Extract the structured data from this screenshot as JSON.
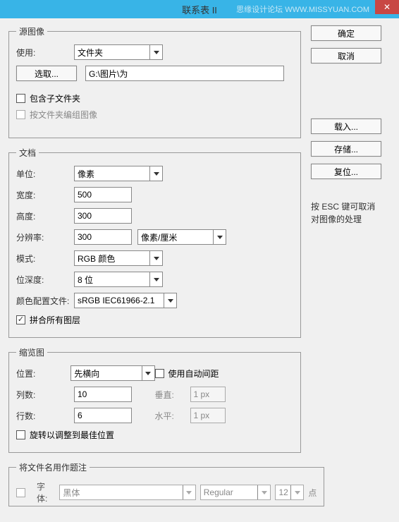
{
  "title": "联系表 II",
  "watermark": "思缘设计论坛  WWW.MISSYUAN.COM",
  "closeIcon": "✕",
  "buttons": {
    "ok": "确定",
    "cancel": "取消",
    "load": "载入...",
    "save": "存储...",
    "reset": "复位...",
    "choose": "选取..."
  },
  "source": {
    "legend": "源图像",
    "useLabel": "使用:",
    "useValue": "文件夹",
    "path": "G:\\图片\\为",
    "includeSub": "包含子文件夹",
    "groupByFolder": "按文件夹编组图像"
  },
  "esc": "按 ESC 键可取消\n对图像的处理",
  "doc": {
    "legend": "文档",
    "unitLabel": "单位:",
    "unitValue": "像素",
    "widthLabel": "宽度:",
    "widthValue": "500",
    "heightLabel": "高度:",
    "heightValue": "300",
    "resLabel": "分辨率:",
    "resValue": "300",
    "resUnit": "像素/厘米",
    "modeLabel": "模式:",
    "modeValue": "RGB 颜色",
    "depthLabel": "位深度:",
    "depthValue": "8 位",
    "profileLabel": "颜色配置文件:",
    "profileValue": "sRGB IEC61966-2.1",
    "flatten": "拼合所有图层"
  },
  "thumb": {
    "legend": "缩览图",
    "posLabel": "位置:",
    "posValue": "先横向",
    "autoSpacing": "使用自动间距",
    "colsLabel": "列数:",
    "colsValue": "10",
    "rowsLabel": "行数:",
    "rowsValue": "6",
    "vLabel": "垂直:",
    "vValue": "1 px",
    "hLabel": "水平:",
    "hValue": "1 px",
    "rotate": "旋转以调整到最佳位置"
  },
  "caption": {
    "legend": "将文件名用作题注",
    "fontLabel": "字体:",
    "fontValue": "黑体",
    "styleValue": "Regular",
    "sizeValue": "12",
    "sizeUnit": "点"
  }
}
